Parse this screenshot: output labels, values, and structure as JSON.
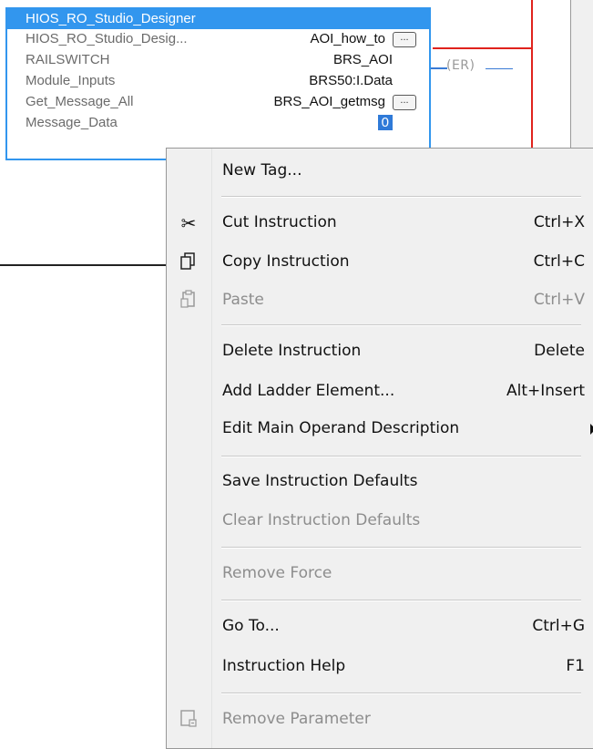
{
  "instruction_block": {
    "title": "HIOS_RO_Studio_Designer",
    "rows": [
      {
        "label": "HIOS_RO_Studio_Desig...",
        "value": "AOI_how_to",
        "has_ellipsis": true
      },
      {
        "label": "RAILSWITCH",
        "value": "BRS_AOI",
        "has_ellipsis": false
      },
      {
        "label": "Module_Inputs",
        "value": "BRS50:I.Data",
        "has_ellipsis": false
      },
      {
        "label": "Get_Message_All",
        "value": "BRS_AOI_getmsg",
        "has_ellipsis": true
      },
      {
        "label": "Message_Data",
        "value": "0",
        "has_ellipsis": false
      }
    ],
    "ellipsis_label": "...",
    "coil_label": "(ER)"
  },
  "context_menu": {
    "items": [
      {
        "label": "New Tag...",
        "shortcut": "",
        "enabled": true,
        "icon": ""
      },
      {
        "label": "Cut Instruction",
        "shortcut": "Ctrl+X",
        "enabled": true,
        "icon": "scissors-icon"
      },
      {
        "label": "Copy Instruction",
        "shortcut": "Ctrl+C",
        "enabled": true,
        "icon": "copy-icon"
      },
      {
        "label": "Paste",
        "shortcut": "Ctrl+V",
        "enabled": false,
        "icon": "paste-icon"
      },
      {
        "label": "Delete Instruction",
        "shortcut": "Delete",
        "enabled": true,
        "icon": ""
      },
      {
        "label": "Add Ladder Element...",
        "shortcut": "Alt+Insert",
        "enabled": true,
        "icon": ""
      },
      {
        "label": "Edit Main Operand Description",
        "shortcut": "",
        "enabled": true,
        "icon": "",
        "submenu": true
      },
      {
        "label": "Save Instruction Defaults",
        "shortcut": "",
        "enabled": true,
        "icon": ""
      },
      {
        "label": "Clear Instruction Defaults",
        "shortcut": "",
        "enabled": false,
        "icon": ""
      },
      {
        "label": "Remove Force",
        "shortcut": "",
        "enabled": false,
        "icon": ""
      },
      {
        "label": "Go To...",
        "shortcut": "Ctrl+G",
        "enabled": true,
        "icon": ""
      },
      {
        "label": "Instruction Help",
        "shortcut": "F1",
        "enabled": true,
        "icon": ""
      },
      {
        "label": "Remove Parameter",
        "shortcut": "",
        "enabled": false,
        "icon": "remove-parameter-icon"
      }
    ]
  },
  "colors": {
    "block_accent": "#3296ee",
    "rail_red": "#e0231d",
    "menu_bg": "#f0f0f0",
    "disabled_text": "#8d8d8d"
  }
}
